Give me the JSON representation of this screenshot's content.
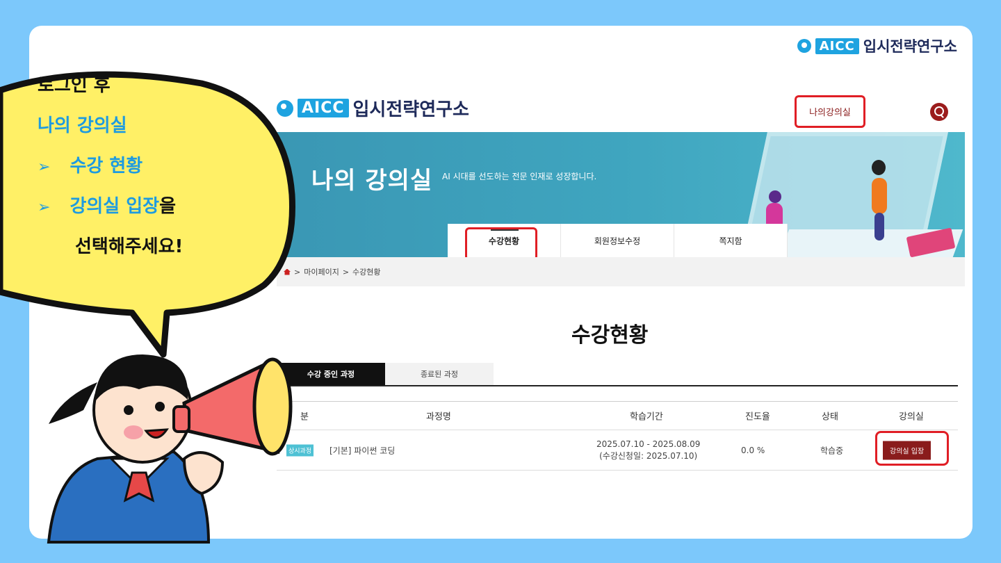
{
  "brand": {
    "badge": "AICC",
    "name": "입시전략연구소"
  },
  "header": {
    "my_lecture_link": "나의강의실"
  },
  "banner": {
    "title": "나의 강의실",
    "subtitle": "AI 시대를 선도하는 전문 인재로 성장합니다."
  },
  "tabs": [
    "수강현황",
    "회원정보수정",
    "쪽지함"
  ],
  "breadcrumb": {
    "items": [
      "마이페이지",
      "수강현황"
    ],
    "separator": ">"
  },
  "page_title": "수강현황",
  "sub_tabs": [
    "수강 중인 과정",
    "종료된 과정"
  ],
  "table": {
    "headers": [
      "분",
      "과정명",
      "학습기간",
      "진도율",
      "상태",
      "강의실"
    ],
    "rows": [
      {
        "badge": "상시과정",
        "course": "[기본] 파이썬 코딩",
        "period": "2025.07.10 - 2025.08.09",
        "applied": "(수강신청일: 2025.07.10)",
        "progress": "0.0 %",
        "status": "학습중",
        "button": "강의실 입장"
      }
    ]
  },
  "callout": {
    "line1": "로그인 후",
    "line2": "나의 강의실",
    "line3": "수강 현황",
    "line4_highlight": "강의실 입장",
    "line4_rest": "을",
    "line5": "선택해주세요!",
    "bullet": "➢"
  },
  "colors": {
    "background": "#7cc8fb",
    "accent_blue": "#1e9be0",
    "highlight_red": "#e01e25",
    "brand_maroon": "#8a1c1c",
    "bubble_yellow": "#fff066"
  }
}
